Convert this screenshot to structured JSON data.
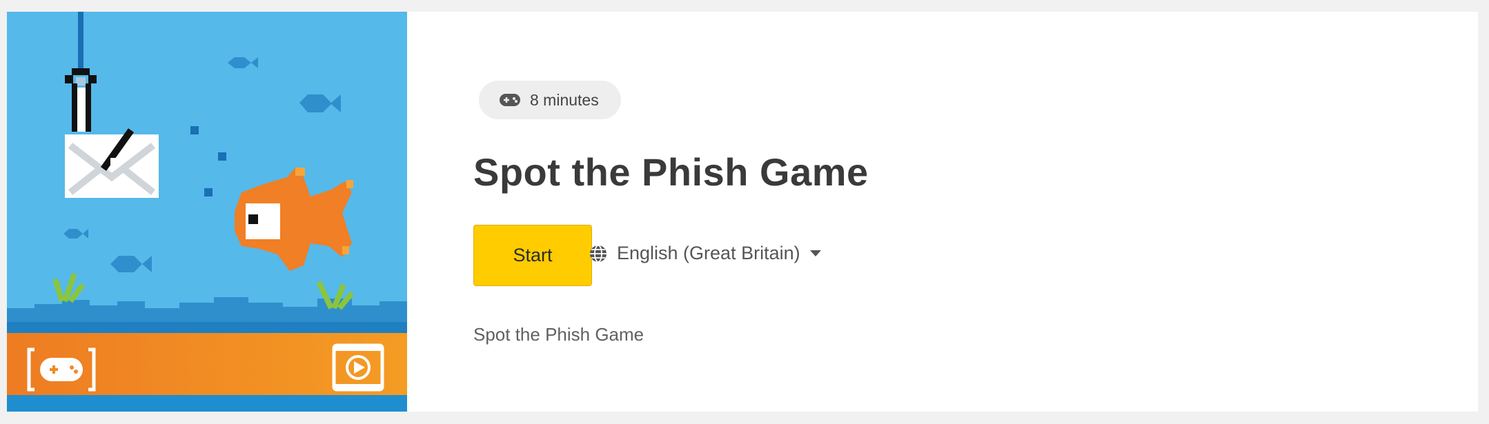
{
  "card": {
    "duration_label": "8 minutes",
    "title": "Spot the Phish Game",
    "start_label": "Start",
    "language": "English (Great Britain)",
    "description": "Spot the Phish Game"
  },
  "thumbnail": {
    "icons": [
      "gamepad-icon",
      "video-play-icon"
    ]
  },
  "icons": {
    "duration": "gamepad-icon",
    "language": "globe-icon",
    "dropdown": "caret-down-icon"
  },
  "colors": {
    "accent": "#ffcc00",
    "sky": "#55b9ea",
    "fish": "#f07f26",
    "banner": "#f08a24"
  }
}
